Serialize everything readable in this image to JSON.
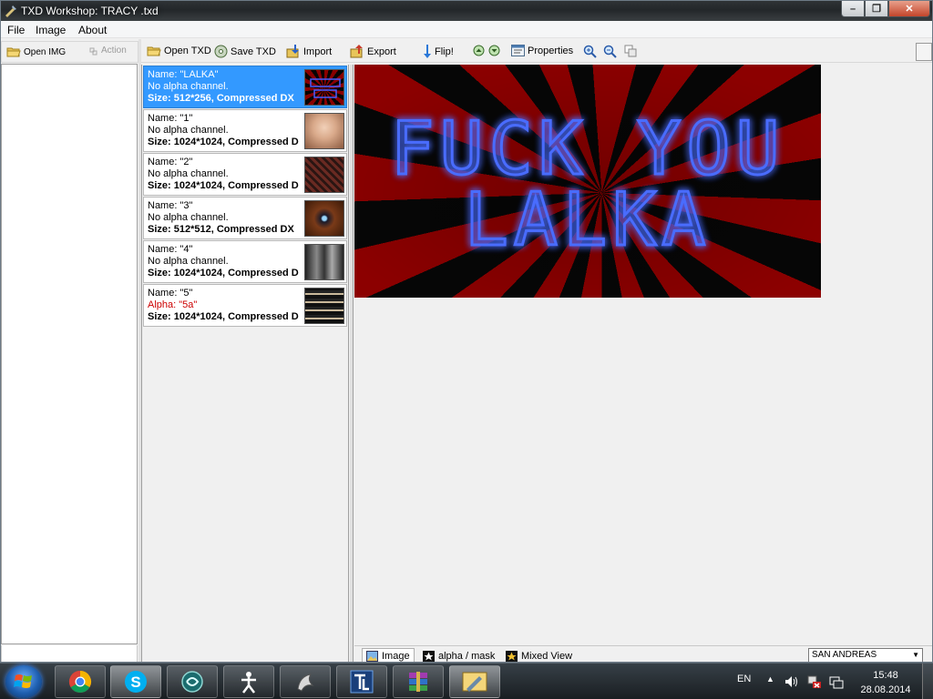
{
  "window": {
    "title": "TXD Workshop: TRACY .txd",
    "minimize": "–",
    "maximize": "❐",
    "close": "✕"
  },
  "menu": [
    "File",
    "Image",
    "About"
  ],
  "left_toolbar": {
    "open_img": "Open IMG",
    "action": "Action"
  },
  "main_toolbar": {
    "open_txd": "Open TXD",
    "save_txd": "Save TXD",
    "import": "Import",
    "export": "Export",
    "flip": "Flip!",
    "properties": "Properties"
  },
  "textures": [
    {
      "name": "Name: \"LALKA\"",
      "alpha": "No alpha channel.",
      "size": "Size: 512*256, Compressed DX",
      "has_alpha": false,
      "selected": true
    },
    {
      "name": "Name: \"1\"",
      "alpha": "No alpha channel.",
      "size": "Size: 1024*1024, Compressed D",
      "has_alpha": false,
      "selected": false
    },
    {
      "name": "Name: \"2\"",
      "alpha": "No alpha channel.",
      "size": "Size: 1024*1024, Compressed D",
      "has_alpha": false,
      "selected": false
    },
    {
      "name": "Name: \"3\"",
      "alpha": "No alpha channel.",
      "size": "Size: 512*512, Compressed DX",
      "has_alpha": false,
      "selected": false
    },
    {
      "name": "Name: \"4\"",
      "alpha": "No alpha channel.",
      "size": "Size: 1024*1024, Compressed D",
      "has_alpha": false,
      "selected": false
    },
    {
      "name": "Name: \"5\"",
      "alpha": "Alpha: \"5a\"",
      "size": "Size: 1024*1024, Compressed D",
      "has_alpha": true,
      "selected": false
    }
  ],
  "preview": {
    "line1": "FUCK YOU",
    "line2": "LALKA"
  },
  "view_tabs": {
    "image": "Image",
    "alpha_mask": "alpha / mask",
    "mixed_view": "Mixed View"
  },
  "game_select": "SAN ANDREAS",
  "taskbar": {
    "language": "EN",
    "time": "15:48",
    "date": "28.08.2014"
  }
}
